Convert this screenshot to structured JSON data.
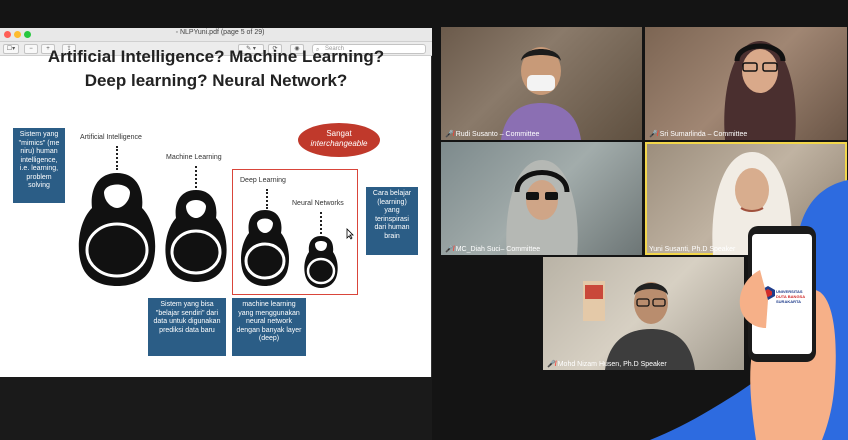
{
  "pdf_viewer": {
    "window_title": "NLPYuni.pdf (page 5 of 29)",
    "search_placeholder": "Search",
    "toolbar": {
      "sidebar_toggle": "☐▾",
      "zoom_out": "−",
      "zoom_in": "+",
      "share": "⇪",
      "markup": "✎ ▾",
      "rotate": "⟳",
      "annotate": "◉"
    }
  },
  "slide": {
    "title_line1": "Artificial Intelligence? Machine Learning?",
    "title_line2": "Deep learning? Neural Network?",
    "labels": {
      "ai": "Artificial Intelligence",
      "ml": "Machine Learning",
      "dl": "Deep Learning",
      "nn": "Neural Networks"
    },
    "bubble_line1": "Sangat",
    "bubble_line2": "interchangeable",
    "callouts": {
      "ai": "Sistem yang \"mimics\" (me niru) human intelligence, i.e. learning, problem solving",
      "ml": "Sistem yang bisa \"belajar sendiri\" dari data untuk digunakan prediksi data baru",
      "dl": "machine learning yang menggunakan neural network dengan banyak layer (deep)",
      "nn": "Cara belajar (learning) yang terinspirasi dari human brain"
    }
  },
  "participants": [
    {
      "name": "Rudi Susanto – Committee",
      "muted": true
    },
    {
      "name": "Sri Sumarlinda – Committee",
      "muted": true
    },
    {
      "name": "MC_Diah Suci– Committee",
      "muted": true
    },
    {
      "name": "Yuni Susanti, Ph.D Speaker",
      "muted": false
    },
    {
      "name": "Mohd Nizam Husen, Ph.D Speaker",
      "muted": true
    }
  ],
  "mute_icon": "🎤̸",
  "phone_logo_text": {
    "line1": "UNIVERSITAS",
    "line2": "DUTA BANGSA",
    "line3": "SURAKARTA"
  },
  "colors": {
    "callout": "#2b5d86",
    "bubble": "#c0392b",
    "active_speaker": "#f2d64b",
    "brand_blue": "#2d6be0"
  }
}
